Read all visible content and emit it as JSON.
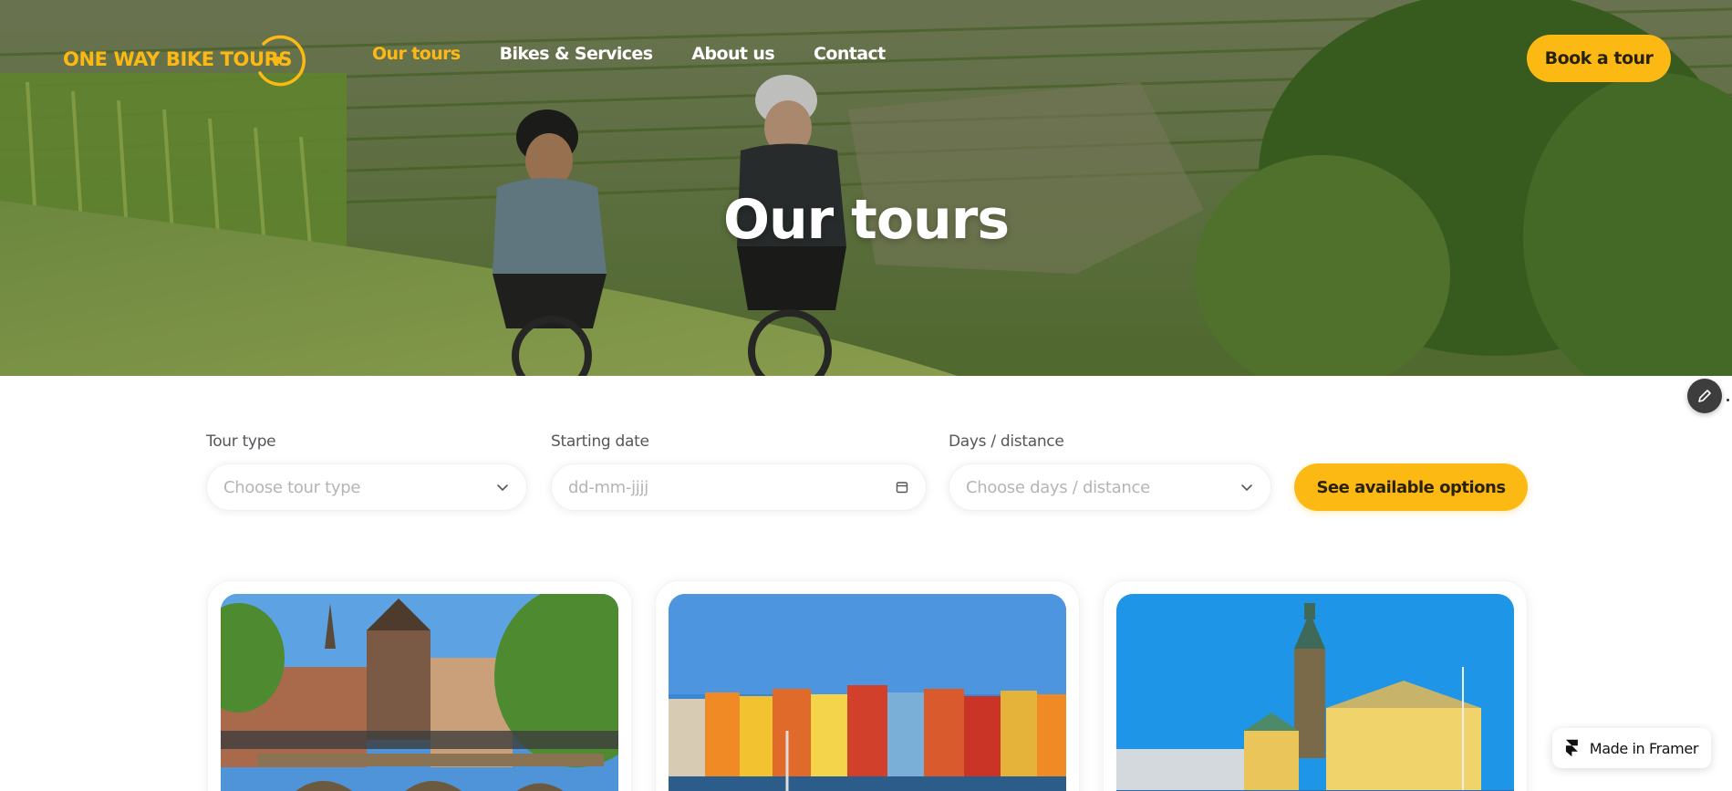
{
  "header": {
    "logo_text": "ONE WAY BIKE TOURS",
    "nav": [
      {
        "label": "Our tours",
        "active": true
      },
      {
        "label": "Bikes & Services",
        "active": false
      },
      {
        "label": "About us",
        "active": false
      },
      {
        "label": "Contact",
        "active": false
      }
    ],
    "cta_label": "Book a tour"
  },
  "hero": {
    "title": "Our tours"
  },
  "filters": {
    "tour_type": {
      "label": "Tour type",
      "placeholder": "Choose tour type"
    },
    "start_date": {
      "label": "Starting date",
      "placeholder": "dd-mm-jjjj"
    },
    "days_distance": {
      "label": "Days / distance",
      "placeholder": "Choose days / distance"
    },
    "submit_label": "See available options"
  },
  "cards": [
    {
      "image": "amsterdam-canal-bridge"
    },
    {
      "image": "copenhagen-nyhavn-harbour"
    },
    {
      "image": "gothenburg-city-hall"
    }
  ],
  "badge": {
    "label": "Made in Framer"
  },
  "colors": {
    "accent": "#fdb913",
    "text_dark": "#2a2208",
    "label_gray": "#55565a",
    "placeholder_gray": "#b4b5b8"
  },
  "icons": [
    "logo-ring-icon",
    "edit-pencil-icon",
    "chevron-down-icon",
    "calendar-icon",
    "framer-logo-icon"
  ]
}
